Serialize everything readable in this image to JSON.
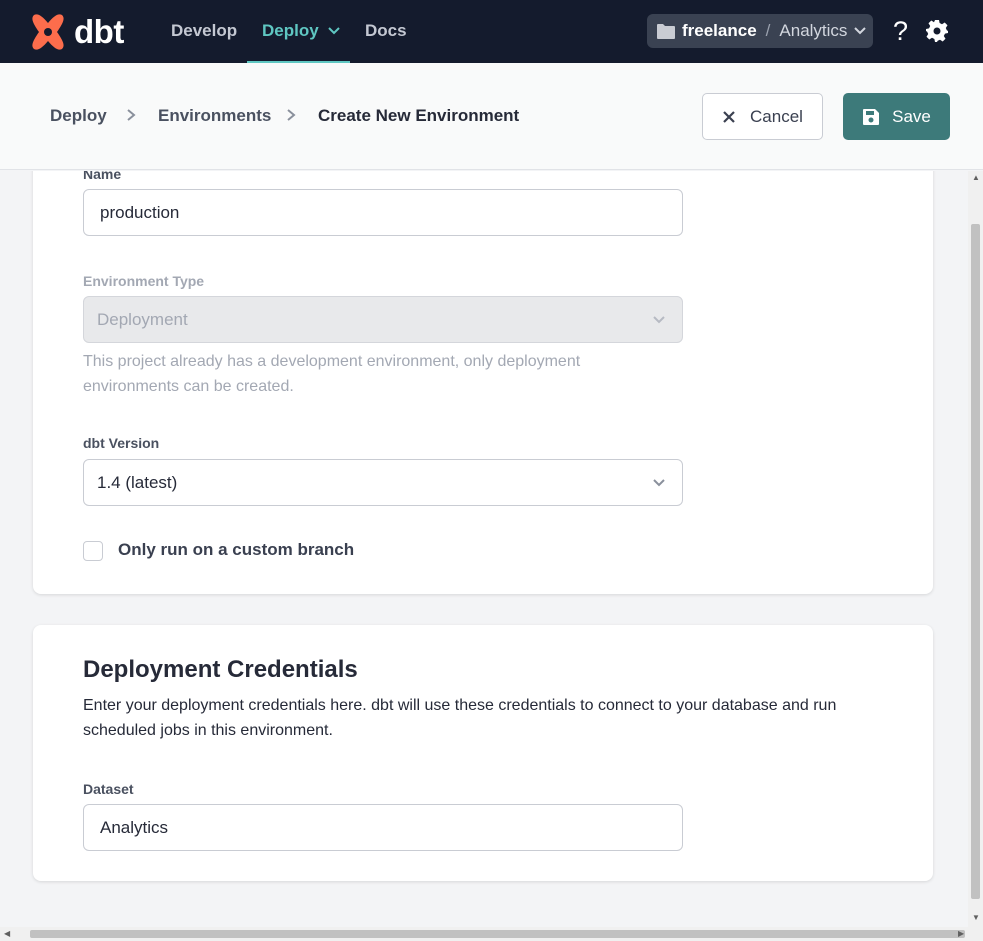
{
  "topnav": {
    "logo_text": "dbt",
    "links": [
      {
        "label": "Develop",
        "active": false
      },
      {
        "label": "Deploy",
        "active": true
      },
      {
        "label": "Docs",
        "active": false
      }
    ],
    "project": {
      "account": "freelance",
      "separator": "/",
      "project": "Analytics"
    },
    "help_label": "?",
    "accent_color": "#5fc7c2",
    "brand_color": "#fc6d4c"
  },
  "breadcrumb": {
    "items": [
      "Deploy",
      "Environments",
      "Create New Environment"
    ]
  },
  "actions": {
    "cancel_label": "Cancel",
    "save_label": "Save",
    "save_color": "#3d7a7a"
  },
  "form": {
    "name": {
      "label": "Name",
      "value": "production"
    },
    "environment_type": {
      "label": "Environment Type",
      "value": "Deployment",
      "disabled": true,
      "help": "This project already has a development environment, only deployment environments can be created."
    },
    "dbt_version": {
      "label": "dbt Version",
      "value": "1.4 (latest)"
    },
    "custom_branch": {
      "label": "Only run on a custom branch",
      "checked": false
    }
  },
  "credentials": {
    "title": "Deployment Credentials",
    "description": "Enter your deployment credentials here. dbt will use these credentials to connect to your database and run scheduled jobs in this environment.",
    "dataset": {
      "label": "Dataset",
      "value": "Analytics"
    }
  }
}
